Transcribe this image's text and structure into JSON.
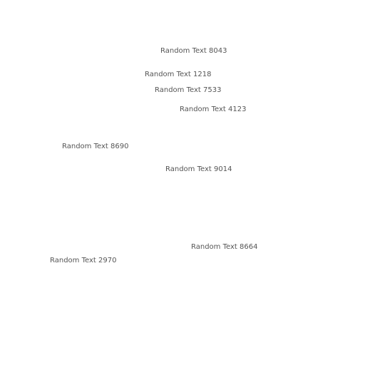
{
  "texts": [
    "Random Text 8043",
    "Random Text 1218",
    "Random Text 7533",
    "Random Text 4123",
    "Random Text 8690",
    "Random Text 9014",
    "Random Text 8664",
    "Random Text 2970"
  ]
}
